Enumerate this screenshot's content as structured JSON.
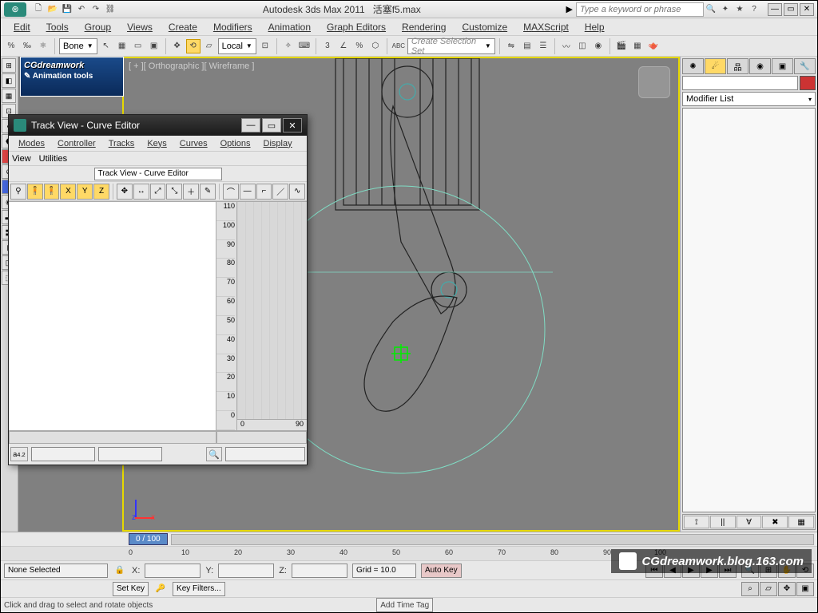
{
  "app": {
    "title_prefix": "Autodesk 3ds Max  2011",
    "filename": "活塞f5.max",
    "search_placeholder": "Type a keyword or phrase"
  },
  "menus": [
    "Edit",
    "Tools",
    "Group",
    "Views",
    "Create",
    "Modifiers",
    "Animation",
    "Graph Editors",
    "Rendering",
    "Customize",
    "MAXScript",
    "Help"
  ],
  "toolbar": {
    "bone_dropdown": "Bone",
    "coord_dropdown": "Local",
    "selection_set": "Create Selection Set"
  },
  "cg_banner": {
    "line1": "CGdreamwork",
    "line2": "Animation tools"
  },
  "viewport": {
    "label": "[ + ][ Orthographic ][ Wireframe ]",
    "axis_x": "x",
    "axis_z": "z"
  },
  "right_panel": {
    "modifier_list": "Modifier List"
  },
  "timeline": {
    "frame_indicator": "0 / 100",
    "ticks": [
      "0",
      "10",
      "20",
      "30",
      "40",
      "50",
      "60",
      "70",
      "80",
      "90",
      "100"
    ]
  },
  "status": {
    "selection": "None Selected",
    "x_label": "X:",
    "x_val": "",
    "y_label": "Y:",
    "y_val": "",
    "z_label": "Z:",
    "z_val": "",
    "grid": "Grid = 10.0",
    "autokey": "Auto Key",
    "setkey": "Set Key",
    "keyfilters": "Key Filters...",
    "hint": "Click and drag to select and rotate objects",
    "add_time_tag": "Add Time Tag"
  },
  "trackview": {
    "title": "Track View - Curve Editor",
    "menus": [
      "Modes",
      "Controller",
      "Tracks",
      "Keys",
      "Curves",
      "Options",
      "Display"
    ],
    "menus2": [
      "View",
      "Utilities"
    ],
    "name_field": "Track View - Curve Editor",
    "y_ticks": [
      "110",
      "100",
      "90",
      "80",
      "70",
      "60",
      "50",
      "40",
      "30",
      "20",
      "10",
      "0"
    ],
    "x_start": "0",
    "x_end": "90",
    "nav_label": "a"
  },
  "watermark": "CGdreamwork.blog.163.com"
}
